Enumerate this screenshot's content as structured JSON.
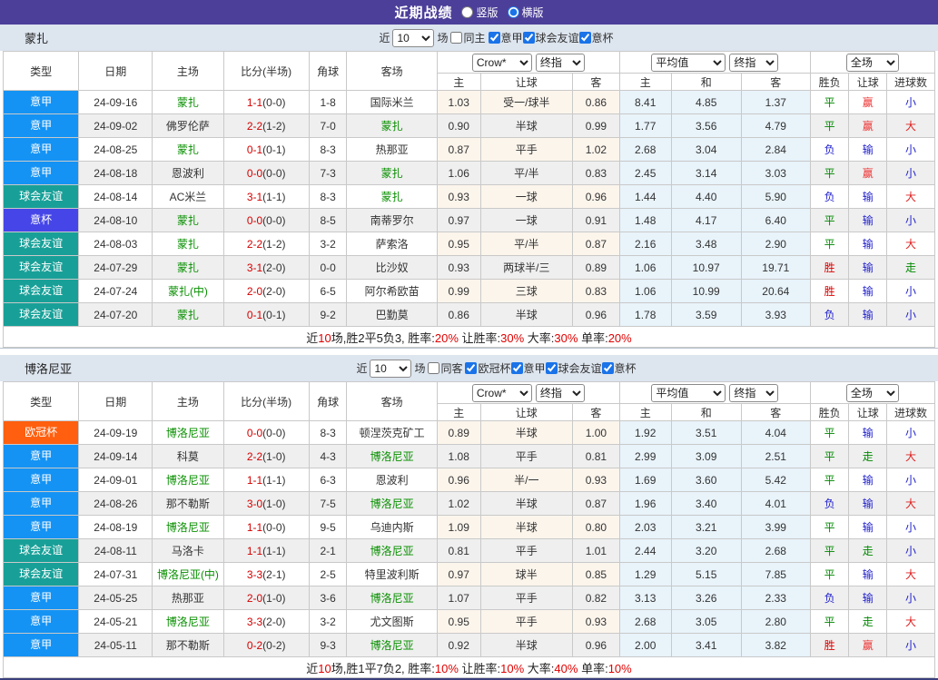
{
  "title_bar": {
    "title": "近期战绩",
    "radio_vertical": "竖版",
    "radio_horizontal": "横版"
  },
  "labels": {
    "near": "近",
    "games": "场"
  },
  "col_headers": {
    "type": "类型",
    "date": "日期",
    "home": "主场",
    "score": "比分(半场)",
    "corner": "角球",
    "away": "客场",
    "crow_select": "Crow*",
    "final_select": "终指",
    "avg_select": "平均值",
    "full_select": "全场",
    "odds_home": "主",
    "odds_handicap": "让球",
    "odds_away": "客",
    "avg_home": "主",
    "avg_draw": "和",
    "avg_away": "客",
    "result_wdl": "胜负",
    "result_handicap": "让球",
    "result_goals": "进球数"
  },
  "type_colors": {
    "意甲": "#1493f4",
    "球会友谊": "#18a098",
    "意杯": "#4646e8",
    "欧冠杯": "#ff5f0f"
  },
  "result_colors": {
    "平": "#008800",
    "胜": "#dd0000",
    "负": "#2222cc",
    "赢": "#ee3333",
    "输": "#2222cc",
    "走": "#008800",
    "大": "#dd2222",
    "小": "#2222cc"
  },
  "sections": [
    {
      "team": "蒙扎",
      "filter": {
        "count": "10",
        "same_label": "同主",
        "same_checked": false,
        "leagues": [
          {
            "label": "意甲",
            "checked": true
          },
          {
            "label": "球会友谊",
            "checked": true
          },
          {
            "label": "意杯",
            "checked": true
          }
        ]
      },
      "rows": [
        {
          "type": "意甲",
          "date": "24-09-16",
          "home": "蒙扎",
          "home_focus": true,
          "score": "1-1",
          "half": "(0-0)",
          "corner": "1-8",
          "away": "国际米兰",
          "away_focus": false,
          "crow": [
            "1.03",
            "受一/球半",
            "0.86"
          ],
          "avg": [
            "8.41",
            "4.85",
            "1.37"
          ],
          "res": [
            "平",
            "赢",
            "小"
          ]
        },
        {
          "type": "意甲",
          "date": "24-09-02",
          "home": "佛罗伦萨",
          "home_focus": false,
          "score": "2-2",
          "half": "(1-2)",
          "corner": "7-0",
          "away": "蒙扎",
          "away_focus": true,
          "crow": [
            "0.90",
            "半球",
            "0.99"
          ],
          "avg": [
            "1.77",
            "3.56",
            "4.79"
          ],
          "res": [
            "平",
            "赢",
            "大"
          ]
        },
        {
          "type": "意甲",
          "date": "24-08-25",
          "home": "蒙扎",
          "home_focus": true,
          "score": "0-1",
          "half": "(0-1)",
          "corner": "8-3",
          "away": "热那亚",
          "away_focus": false,
          "crow": [
            "0.87",
            "平手",
            "1.02"
          ],
          "avg": [
            "2.68",
            "3.04",
            "2.84"
          ],
          "res": [
            "负",
            "输",
            "小"
          ]
        },
        {
          "type": "意甲",
          "date": "24-08-18",
          "home": "恩波利",
          "home_focus": false,
          "score": "0-0",
          "half": "(0-0)",
          "corner": "7-3",
          "away": "蒙扎",
          "away_focus": true,
          "crow": [
            "1.06",
            "平/半",
            "0.83"
          ],
          "avg": [
            "2.45",
            "3.14",
            "3.03"
          ],
          "res": [
            "平",
            "赢",
            "小"
          ]
        },
        {
          "type": "球会友谊",
          "date": "24-08-14",
          "home": "AC米兰",
          "home_focus": false,
          "score": "3-1",
          "half": "(1-1)",
          "corner": "8-3",
          "away": "蒙扎",
          "away_focus": true,
          "crow": [
            "0.93",
            "一球",
            "0.96"
          ],
          "avg": [
            "1.44",
            "4.40",
            "5.90"
          ],
          "res": [
            "负",
            "输",
            "大"
          ]
        },
        {
          "type": "意杯",
          "date": "24-08-10",
          "home": "蒙扎",
          "home_focus": true,
          "score": "0-0",
          "half": "(0-0)",
          "corner": "8-5",
          "away": "南蒂罗尔",
          "away_focus": false,
          "crow": [
            "0.97",
            "一球",
            "0.91"
          ],
          "avg": [
            "1.48",
            "4.17",
            "6.40"
          ],
          "res": [
            "平",
            "输",
            "小"
          ]
        },
        {
          "type": "球会友谊",
          "date": "24-08-03",
          "home": "蒙扎",
          "home_focus": true,
          "score": "2-2",
          "half": "(1-2)",
          "corner": "3-2",
          "away": "萨索洛",
          "away_focus": false,
          "crow": [
            "0.95",
            "平/半",
            "0.87"
          ],
          "avg": [
            "2.16",
            "3.48",
            "2.90"
          ],
          "res": [
            "平",
            "输",
            "大"
          ]
        },
        {
          "type": "球会友谊",
          "date": "24-07-29",
          "home": "蒙扎",
          "home_focus": true,
          "score": "3-1",
          "half": "(2-0)",
          "corner": "0-0",
          "away": "比沙奴",
          "away_focus": false,
          "crow": [
            "0.93",
            "两球半/三",
            "0.89"
          ],
          "avg": [
            "1.06",
            "10.97",
            "19.71"
          ],
          "res": [
            "胜",
            "输",
            "走"
          ]
        },
        {
          "type": "球会友谊",
          "date": "24-07-24",
          "home": "蒙扎(中)",
          "home_focus": true,
          "score": "2-0",
          "half": "(2-0)",
          "corner": "6-5",
          "away": "阿尔希欧苗",
          "away_focus": false,
          "crow": [
            "0.99",
            "三球",
            "0.83"
          ],
          "avg": [
            "1.06",
            "10.99",
            "20.64"
          ],
          "res": [
            "胜",
            "输",
            "小"
          ]
        },
        {
          "type": "球会友谊",
          "date": "24-07-20",
          "home": "蒙扎",
          "home_focus": true,
          "score": "0-1",
          "half": "(0-1)",
          "corner": "9-2",
          "away": "巴勤莫",
          "away_focus": false,
          "crow": [
            "0.86",
            "半球",
            "0.96"
          ],
          "avg": [
            "1.78",
            "3.59",
            "3.93"
          ],
          "res": [
            "负",
            "输",
            "小"
          ]
        }
      ],
      "summary_parts": [
        [
          "近",
          "b"
        ],
        [
          "10",
          "r"
        ],
        [
          "场,胜2平5负3, 胜率:",
          "b"
        ],
        [
          "20%",
          "r"
        ],
        [
          " 让胜率:",
          "b"
        ],
        [
          "30%",
          "r"
        ],
        [
          " 大率:",
          "b"
        ],
        [
          "30%",
          "r"
        ],
        [
          " 单率:",
          "b"
        ],
        [
          "20%",
          "r"
        ]
      ]
    },
    {
      "team": "博洛尼亚",
      "filter": {
        "count": "10",
        "same_label": "同客",
        "same_checked": false,
        "leagues": [
          {
            "label": "欧冠杯",
            "checked": true
          },
          {
            "label": "意甲",
            "checked": true
          },
          {
            "label": "球会友谊",
            "checked": true
          },
          {
            "label": "意杯",
            "checked": true
          }
        ]
      },
      "rows": [
        {
          "type": "欧冠杯",
          "date": "24-09-19",
          "home": "博洛尼亚",
          "home_focus": true,
          "score": "0-0",
          "half": "(0-0)",
          "corner": "8-3",
          "away": "顿涅茨克矿工",
          "away_focus": false,
          "crow": [
            "0.89",
            "半球",
            "1.00"
          ],
          "avg": [
            "1.92",
            "3.51",
            "4.04"
          ],
          "res": [
            "平",
            "输",
            "小"
          ]
        },
        {
          "type": "意甲",
          "date": "24-09-14",
          "home": "科莫",
          "home_focus": false,
          "score": "2-2",
          "half": "(1-0)",
          "corner": "4-3",
          "away": "博洛尼亚",
          "away_focus": true,
          "crow": [
            "1.08",
            "平手",
            "0.81"
          ],
          "avg": [
            "2.99",
            "3.09",
            "2.51"
          ],
          "res": [
            "平",
            "走",
            "大"
          ]
        },
        {
          "type": "意甲",
          "date": "24-09-01",
          "home": "博洛尼亚",
          "home_focus": true,
          "score": "1-1",
          "half": "(1-1)",
          "corner": "6-3",
          "away": "恩波利",
          "away_focus": false,
          "crow": [
            "0.96",
            "半/一",
            "0.93"
          ],
          "avg": [
            "1.69",
            "3.60",
            "5.42"
          ],
          "res": [
            "平",
            "输",
            "小"
          ]
        },
        {
          "type": "意甲",
          "date": "24-08-26",
          "home": "那不勒斯",
          "home_focus": false,
          "score": "3-0",
          "half": "(1-0)",
          "corner": "7-5",
          "away": "博洛尼亚",
          "away_focus": true,
          "crow": [
            "1.02",
            "半球",
            "0.87"
          ],
          "avg": [
            "1.96",
            "3.40",
            "4.01"
          ],
          "res": [
            "负",
            "输",
            "大"
          ]
        },
        {
          "type": "意甲",
          "date": "24-08-19",
          "home": "博洛尼亚",
          "home_focus": true,
          "score": "1-1",
          "half": "(0-0)",
          "corner": "9-5",
          "away": "乌迪内斯",
          "away_focus": false,
          "crow": [
            "1.09",
            "半球",
            "0.80"
          ],
          "avg": [
            "2.03",
            "3.21",
            "3.99"
          ],
          "res": [
            "平",
            "输",
            "小"
          ]
        },
        {
          "type": "球会友谊",
          "date": "24-08-11",
          "home": "马洛卡",
          "home_focus": false,
          "score": "1-1",
          "half": "(1-1)",
          "corner": "2-1",
          "away": "博洛尼亚",
          "away_focus": true,
          "crow": [
            "0.81",
            "平手",
            "1.01"
          ],
          "avg": [
            "2.44",
            "3.20",
            "2.68"
          ],
          "res": [
            "平",
            "走",
            "小"
          ]
        },
        {
          "type": "球会友谊",
          "date": "24-07-31",
          "home": "博洛尼亚(中)",
          "home_focus": true,
          "score": "3-3",
          "half": "(2-1)",
          "corner": "2-5",
          "away": "特里波利斯",
          "away_focus": false,
          "crow": [
            "0.97",
            "球半",
            "0.85"
          ],
          "avg": [
            "1.29",
            "5.15",
            "7.85"
          ],
          "res": [
            "平",
            "输",
            "大"
          ]
        },
        {
          "type": "意甲",
          "date": "24-05-25",
          "home": "热那亚",
          "home_focus": false,
          "score": "2-0",
          "half": "(1-0)",
          "corner": "3-6",
          "away": "博洛尼亚",
          "away_focus": true,
          "crow": [
            "1.07",
            "平手",
            "0.82"
          ],
          "avg": [
            "3.13",
            "3.26",
            "2.33"
          ],
          "res": [
            "负",
            "输",
            "小"
          ]
        },
        {
          "type": "意甲",
          "date": "24-05-21",
          "home": "博洛尼亚",
          "home_focus": true,
          "score": "3-3",
          "half": "(2-0)",
          "corner": "3-2",
          "away": "尤文图斯",
          "away_focus": false,
          "crow": [
            "0.95",
            "平手",
            "0.93"
          ],
          "avg": [
            "2.68",
            "3.05",
            "2.80"
          ],
          "res": [
            "平",
            "走",
            "大"
          ]
        },
        {
          "type": "意甲",
          "date": "24-05-11",
          "home": "那不勒斯",
          "home_focus": false,
          "score": "0-2",
          "half": "(0-2)",
          "corner": "9-3",
          "away": "博洛尼亚",
          "away_focus": true,
          "crow": [
            "0.92",
            "半球",
            "0.96"
          ],
          "avg": [
            "2.00",
            "3.41",
            "3.82"
          ],
          "res": [
            "胜",
            "赢",
            "小"
          ]
        }
      ],
      "summary_parts": [
        [
          "近",
          "b"
        ],
        [
          "10",
          "r"
        ],
        [
          "场,胜1平7负2, 胜率:",
          "b"
        ],
        [
          "10%",
          "r"
        ],
        [
          " 让胜率:",
          "b"
        ],
        [
          "10%",
          "r"
        ],
        [
          " 大率:",
          "b"
        ],
        [
          "40%",
          "r"
        ],
        [
          " 单率:",
          "b"
        ],
        [
          "10%",
          "r"
        ]
      ]
    }
  ]
}
